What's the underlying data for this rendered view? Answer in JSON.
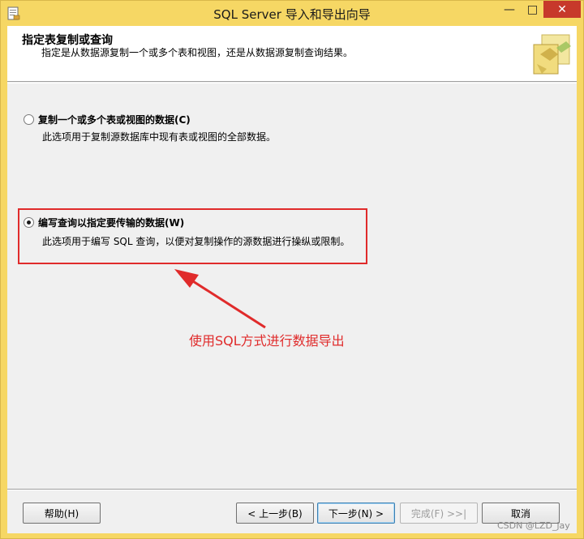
{
  "window": {
    "title": "SQL Server 导入和导出向导",
    "minimize_glyph": "—",
    "maximize_glyph": "□",
    "close_glyph": "✕"
  },
  "header": {
    "title": "指定表复制或查询",
    "subtitle": "指定是从数据源复制一个或多个表和视图，还是从数据源复制查询结果。"
  },
  "options": [
    {
      "label": "复制一个或多个表或视图的数据(C)",
      "description": "此选项用于复制源数据库中现有表或视图的全部数据。",
      "selected": false
    },
    {
      "label": "编写查询以指定要传输的数据(W)",
      "description": "此选项用于编写 SQL 查询，以便对复制操作的源数据进行操纵或限制。",
      "selected": true
    }
  ],
  "annotation": {
    "text": "使用SQL方式进行数据导出",
    "color": "#e02b2b"
  },
  "buttons": {
    "help": "帮助(H)",
    "back": "< 上一步(B)",
    "next": "下一步(N) >",
    "finish": "完成(F) >>|",
    "cancel": "取消"
  },
  "watermark": "CSDN @LZD_jay",
  "colors": {
    "title_bar": "#f6d764",
    "close_button": "#c7392b",
    "dialog_bg": "#f0f0f0",
    "header_bg": "#ffffff"
  }
}
